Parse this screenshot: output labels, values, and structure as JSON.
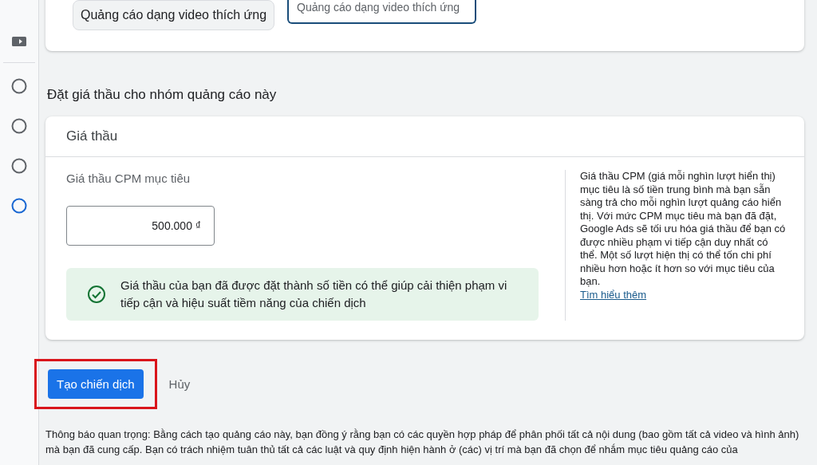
{
  "sidebar": {
    "steps": [
      {
        "kind": "video",
        "selected": false
      },
      {
        "kind": "circle",
        "selected": false
      },
      {
        "kind": "circle",
        "selected": false
      },
      {
        "kind": "circle",
        "selected": false
      },
      {
        "kind": "circle",
        "selected": true
      }
    ]
  },
  "format_card": {
    "chip": "Quảng cáo dạng video thích ứng",
    "field": {
      "value": "Quảng cáo dạng video thích ứng"
    }
  },
  "section_title": "Đặt giá thầu cho nhóm quảng cáo này",
  "bid_card": {
    "title": "Giá thầu",
    "field_label": "Giá thầu CPM mục tiêu",
    "field": {
      "value": "500.000 ₫"
    },
    "notice": "Giá thầu của bạn đã được đặt thành số tiền có thể giúp cải thiện phạm vi tiếp cận và hiệu suất tiềm năng của chiến dịch",
    "help": "Giá thầu CPM (giá mỗi nghìn lượt hiển thị) mục tiêu là số tiền trung bình mà bạn sẵn sàng trả cho mỗi nghìn lượt quảng cáo hiển thị. Với mức CPM mục tiêu mà bạn đã đặt, Google Ads sẽ tối ưu hóa giá thầu để bạn có được nhiều phạm vi tiếp cận duy nhất có thể. Một số lượt hiện thị có thể tốn chi phí nhiều hơn hoặc ít hơn so với mục tiêu của bạn.",
    "help_link": "Tìm hiểu thêm"
  },
  "actions": [
    {
      "kind": "primary",
      "label": "Tạo chiến dịch",
      "highlighted": true
    },
    {
      "kind": "text",
      "label": "Hủy",
      "highlighted": false
    }
  ],
  "legal": "Thông báo quan trọng: Bằng cách tạo quảng cáo này, bạn đồng ý rằng bạn có các quyền hợp pháp để phân phối tất cả nội dung (bao gồm tất cả video và hình ảnh) mà bạn đã cung cấp. Bạn có trách nhiệm tuân thủ tất cả các luật và quy định hiện hành ở (các) vị trí mà bạn đã chọn để nhắm mục tiêu quảng cáo của"
}
